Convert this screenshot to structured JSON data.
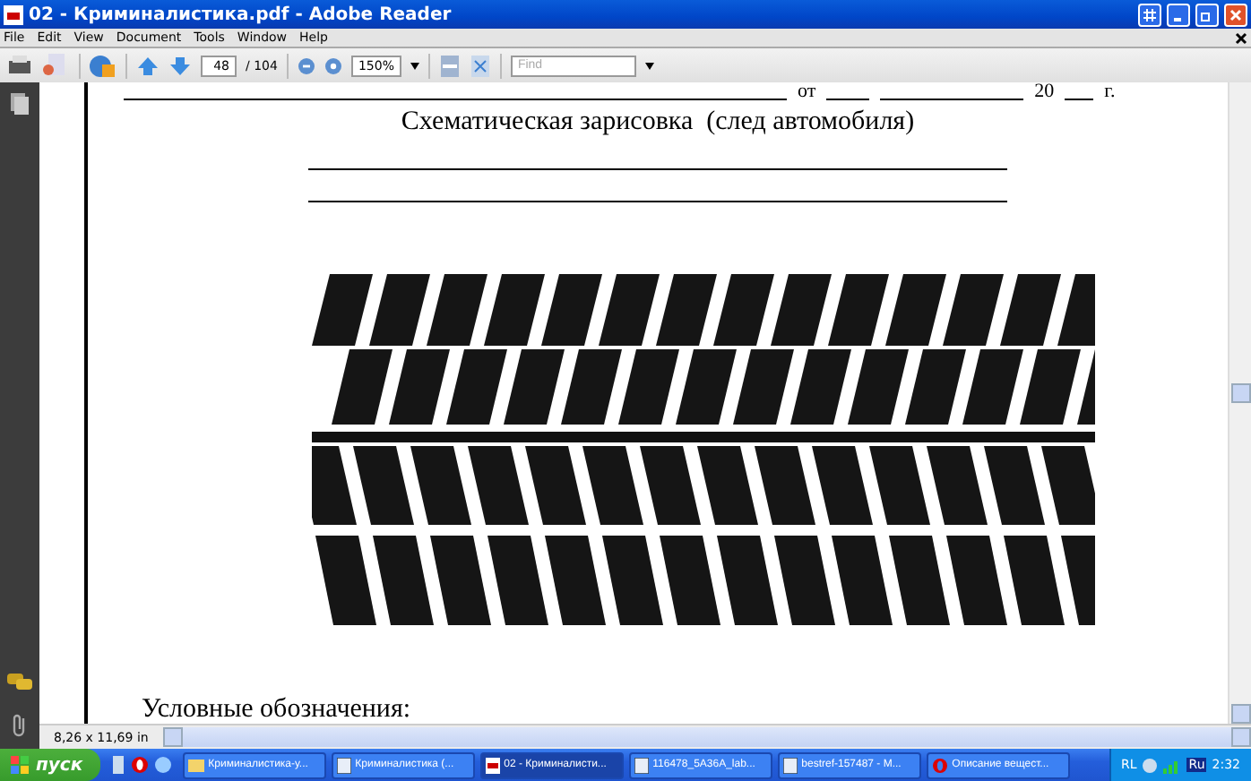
{
  "window": {
    "title": "02 - Криминалистика.pdf - Adobe Reader"
  },
  "menu": [
    "File",
    "Edit",
    "View",
    "Document",
    "Tools",
    "Window",
    "Help"
  ],
  "toolbar": {
    "page": "48",
    "page_count": "/ 104",
    "zoom": "150%",
    "find": {
      "placeholder": "Find"
    }
  },
  "document": {
    "top_line": [
      "от",
      "20",
      "г."
    ],
    "heading": "Схематическая зарисовка  (след автомобиля)",
    "footer_heading": "Условные обозначения:"
  },
  "status_bar": {
    "page_size": "8,26 x 11,69 in"
  },
  "taskbar": {
    "start": "пуск",
    "tasks": [
      {
        "label": "Криминалистика-у...",
        "kind": "folder",
        "selected": false
      },
      {
        "label": "Криминалистика (...",
        "kind": "doc",
        "selected": false
      },
      {
        "label": "02 - Криминалисти...",
        "kind": "pdf",
        "selected": true
      },
      {
        "label": "116478_5A36A_lab...",
        "kind": "doc",
        "selected": false
      },
      {
        "label": "bestref-157487 - M...",
        "kind": "doc",
        "selected": false
      },
      {
        "label": "Описание вещест...",
        "kind": "opera",
        "selected": false
      }
    ],
    "tray": {
      "lang": "RL",
      "keyboard": "Ru",
      "clock": "2:32"
    }
  }
}
